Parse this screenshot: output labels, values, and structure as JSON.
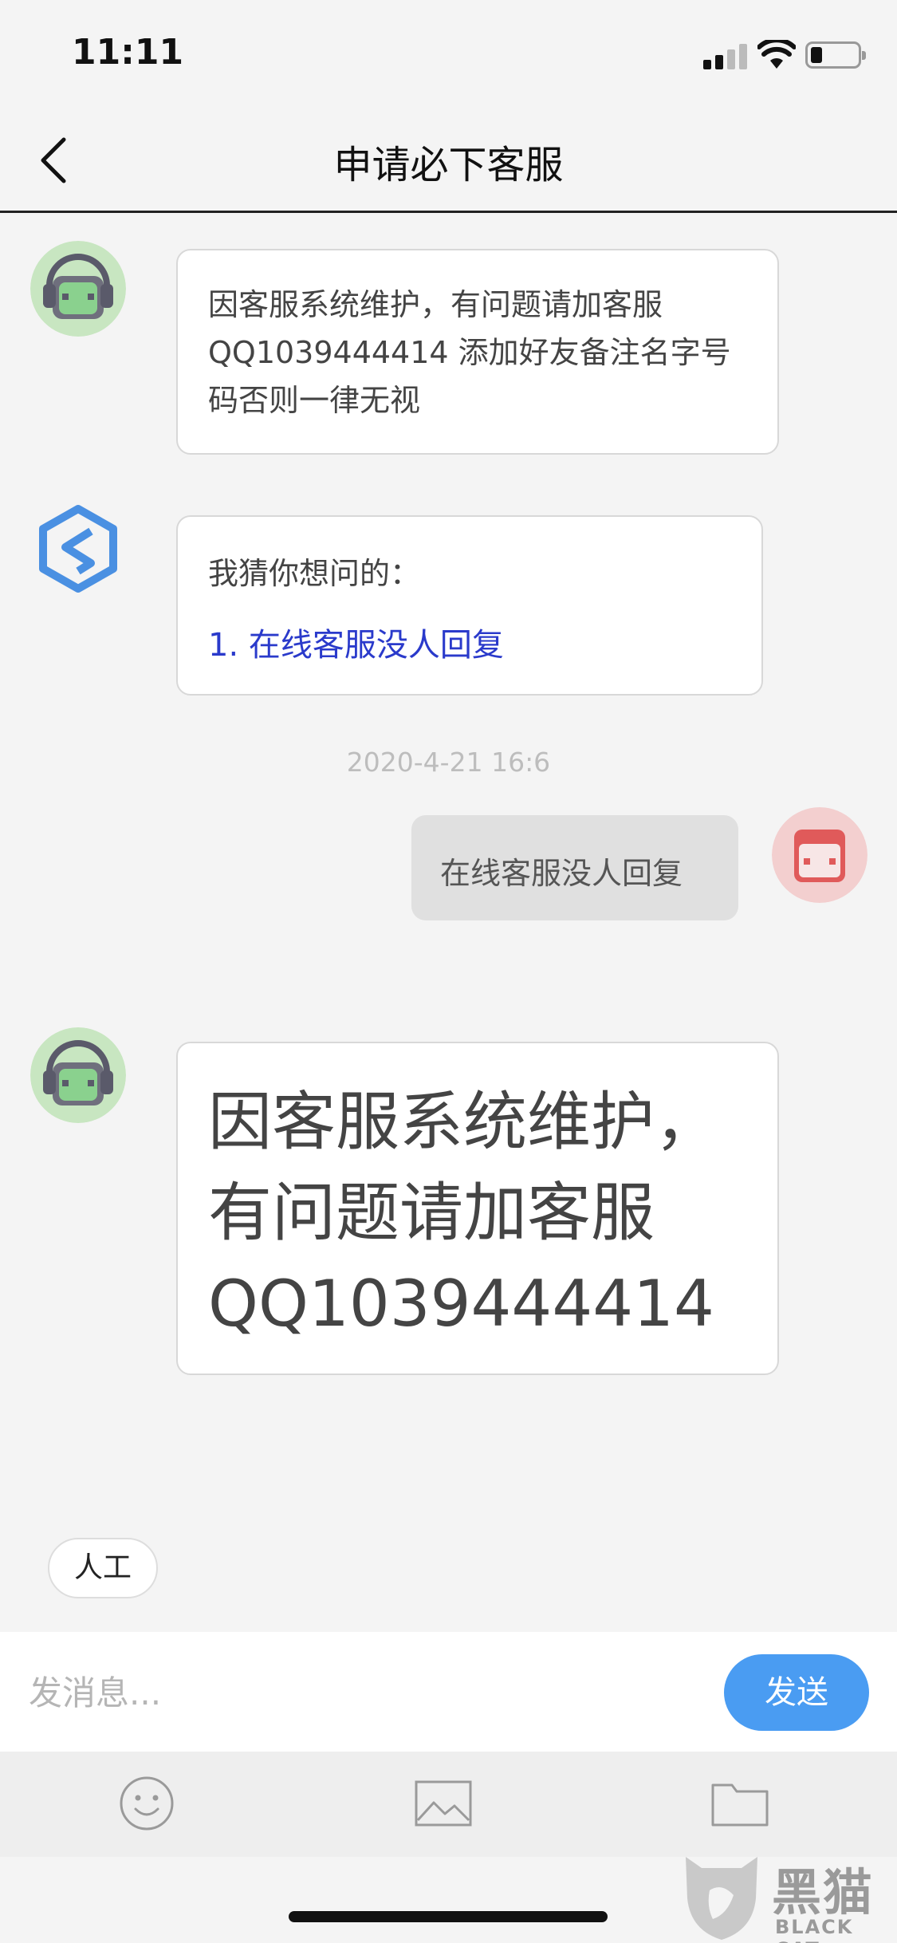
{
  "status_bar": {
    "time": "11:11"
  },
  "nav": {
    "title": "申请必下客服"
  },
  "messages": {
    "agent_notice": "因客服系统维护，有问题请加客服QQ1039444414 添加好友备注名字号码否则一律无视",
    "faq": {
      "title": "我猜你想问的：",
      "items": [
        "1. 在线客服没人回复"
      ]
    },
    "timestamp": "2020-4-21 16:6",
    "user_message": "在线客服没人回复",
    "agent_big_notice": "因客服系统维护，有问题请加客服QQ1039444414"
  },
  "quick_reply": {
    "label": "人工"
  },
  "input": {
    "placeholder": "发消息...",
    "send_label": "发送"
  },
  "toolbar": {
    "icons": [
      "emoji-icon",
      "image-icon",
      "folder-icon"
    ]
  },
  "watermark": {
    "text": "黑猫",
    "subtext": "BLACK CAT"
  },
  "colors": {
    "accent": "#4a9cf2",
    "link": "#2a3acb",
    "agent_avatar_bg": "#c8e6c1",
    "user_avatar_bg": "#f3cfcf",
    "user_avatar_face": "#e05a5a",
    "bot_logo": "#4a90e2"
  }
}
